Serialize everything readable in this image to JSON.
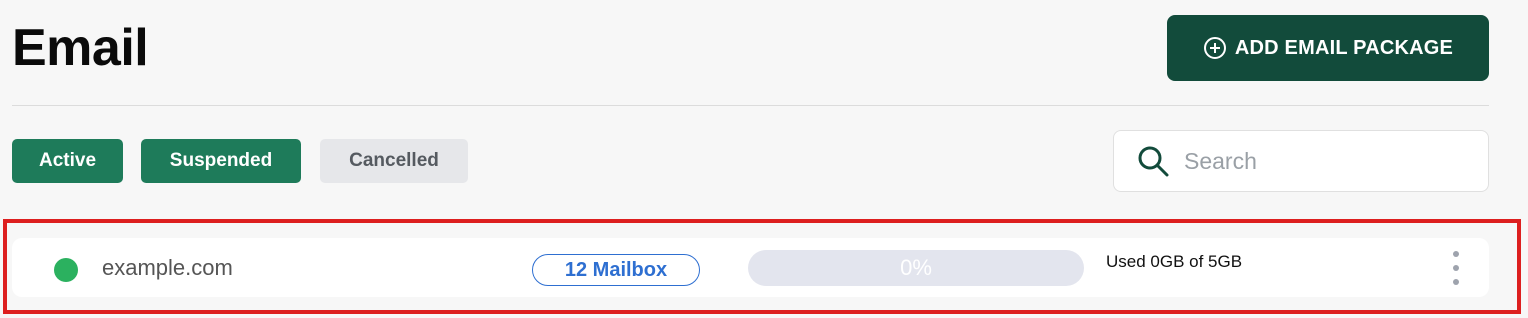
{
  "header": {
    "title": "Email",
    "add_button_label": "ADD EMAIL PACKAGE",
    "add_button_icon": "plus-circle-icon"
  },
  "tabs": [
    {
      "label": "Active",
      "state": "selected"
    },
    {
      "label": "Suspended",
      "state": "selected"
    },
    {
      "label": "Cancelled",
      "state": "unselected"
    }
  ],
  "search": {
    "placeholder": "Search",
    "value": "",
    "icon": "search-icon"
  },
  "packages": [
    {
      "domain": "example.com",
      "status": "active",
      "status_color": "#2bb15f",
      "mailbox_label": "12 Mailbox",
      "usage_percent_label": "0%",
      "usage_fraction": 0,
      "usage_text": "Used 0GB of 5GB",
      "menu_icon": "kebab-menu-icon"
    }
  ],
  "colors": {
    "brand_dark": "#124b3b",
    "brand": "#1e7b5a",
    "link_blue": "#2e6fd1",
    "highlight_red": "#dd1f1f"
  }
}
